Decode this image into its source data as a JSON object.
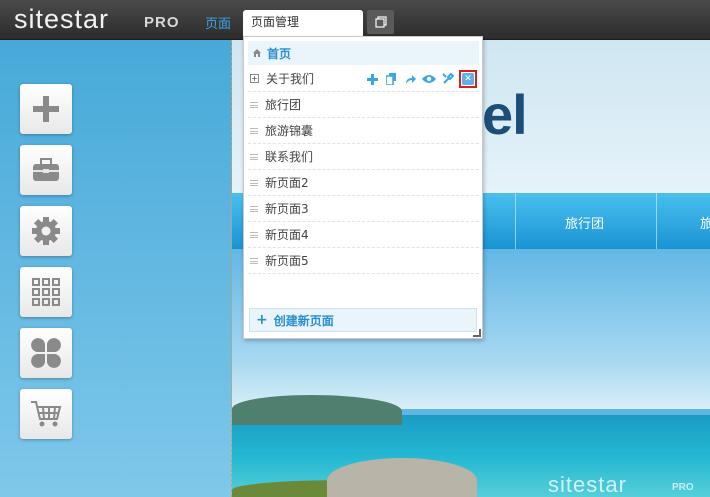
{
  "topbar": {
    "logo_text": "sitestar",
    "logo_suffix": "PRO",
    "pages_label": "页面",
    "page_select_value": "页面管理"
  },
  "preview": {
    "hero_title": "el",
    "menu_items": [
      "旅行团",
      "旅"
    ],
    "watermark_text": "sitestar",
    "watermark_suffix": "PRO"
  },
  "page_manager": {
    "home_label": "首页",
    "pages": [
      {
        "label": "关于我们",
        "expandable": true,
        "expand_glyph": "+"
      },
      {
        "label": "旅行团"
      },
      {
        "label": "旅游锦囊"
      },
      {
        "label": "联系我们"
      },
      {
        "label": "新页面2"
      },
      {
        "label": "新页面3"
      },
      {
        "label": "新页面4"
      },
      {
        "label": "新页面5"
      }
    ],
    "row_actions": [
      "add-icon",
      "copy-icon",
      "redirect-icon",
      "view-icon",
      "settings-icon",
      "delete-icon"
    ],
    "create_label": "创建新页面",
    "create_glyph": "+"
  },
  "sidebar": {
    "tools": [
      "add-icon",
      "toolbox-icon",
      "gear-icon",
      "grid-icon",
      "clover-icon",
      "cart-icon"
    ]
  },
  "colors": {
    "accent": "#3aa6e6",
    "highlight": "#d62020",
    "topbar": "#333333"
  }
}
